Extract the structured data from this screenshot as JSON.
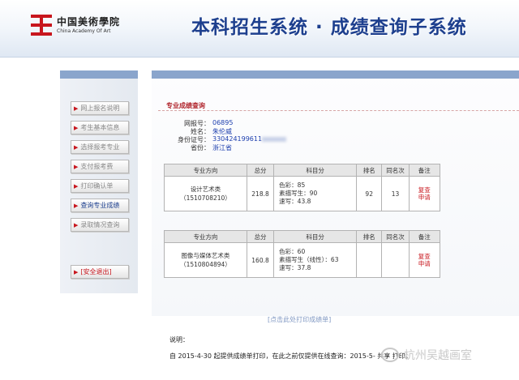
{
  "header": {
    "logo_cn": "中国美術學院",
    "logo_en": "China Academy Of Art",
    "system_title": "本科招生系统 · 成绩查询子系统"
  },
  "sidebar": {
    "items": [
      {
        "label": "网上报名说明",
        "active": false
      },
      {
        "label": "考生基本信息",
        "active": false
      },
      {
        "label": "选择报考专业",
        "active": false
      },
      {
        "label": "支付报考费",
        "active": false
      },
      {
        "label": "打印确认单",
        "active": false
      },
      {
        "label": "查询专业成绩",
        "active": true
      },
      {
        "label": "录取情况查询",
        "active": false
      }
    ],
    "logout": "[安全退出]"
  },
  "main": {
    "section_title": "专业成绩查询",
    "info": {
      "seat_label": "网报号：",
      "seat_value": "06895",
      "name_label": "姓名：",
      "name_value": "朱伦威",
      "id_label": "身份证号：",
      "id_value": "330424199611",
      "province_label": "省份：",
      "province_value": "浙江省"
    },
    "table_headers": [
      "专业方向",
      "总分",
      "科目分",
      "排名",
      "同名次",
      "备注"
    ],
    "rows": [
      {
        "major": "设计艺术类",
        "code": "（1510708210）",
        "total": "218.8",
        "subjects": [
          "色彩：85",
          "素描写生：90",
          "速写：43.8"
        ],
        "rank": "92",
        "tie": "13",
        "note_1": "复查",
        "note_2": "申请"
      },
      {
        "major": "图像与媒体艺术类",
        "code": "（1510804894）",
        "total": "160.8",
        "subjects": [
          "色彩：60",
          "素描写生（线性）：63",
          "速写：37.8"
        ],
        "rank": "",
        "tie": "",
        "note_1": "复查",
        "note_2": "申请"
      }
    ],
    "print_link": "[点击此处打印成绩单]"
  },
  "notes": {
    "label": "说明：",
    "text": "自 2015-4-30 起提供成绩单打印，在此之前仅提供在线查询：2015-5-   共享    打印。"
  },
  "watermark": "杭州吴越画室",
  "colors": {
    "brand_blue": "#1d3f8e",
    "accent_red": "#c8161d",
    "panel_blue": "#8aa5cc"
  }
}
